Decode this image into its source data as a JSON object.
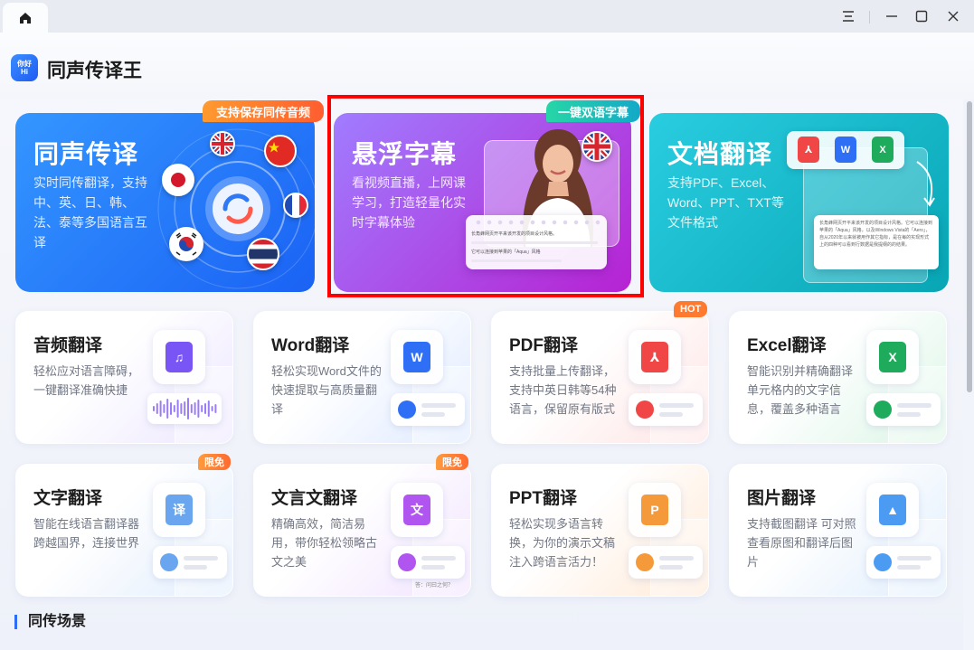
{
  "window": {
    "home_tab_icon": "home-icon",
    "controls": [
      "menu-icon",
      "minimize-icon",
      "maximize-icon",
      "close-icon"
    ]
  },
  "app": {
    "title": "同声传译王",
    "logo_text": "你好\nHi"
  },
  "hero_cards": [
    {
      "id": "simultaneous",
      "title": "同声传译",
      "desc": "实时同传翻译，支持中、英、日、韩、法、泰等多国语言互译",
      "ribbon": "支持保存同传音频",
      "colors": {
        "from": "#2f8cff",
        "to": "#1257f2",
        "ribbon": "#ff7a2f"
      }
    },
    {
      "id": "floating-subtitle",
      "title": "悬浮字幕",
      "desc": "看视频直播，上网课学习，打造轻量化实时字幕体验",
      "ribbon": "一键双语字幕",
      "subtitle_line1": "长角蜂网页开平来该开发的项目设计风格。",
      "subtitle_line2": "它可以连接到苹果的「Aqua」风格",
      "colors": {
        "from": "#a57bff",
        "to": "#b21fd6",
        "ribbon": "#1fc3a5"
      }
    },
    {
      "id": "document",
      "title": "文档翻译",
      "desc": "支持PDF、Excel、Word、PPT、TXT等文件格式",
      "doc_text": "长角蜂网页开平来该开发的项目设计风格。它可以连接到苹果的「Aqua」风格，以及Windows Vista的「Aero」，自从2020年以来就被用作其它指标，是在每的实现形式上的四种可以看到行数据是我提纲的的结果。",
      "colors": {
        "from": "#23c7d9",
        "to": "#0aa7b8"
      }
    }
  ],
  "cards": [
    {
      "id": "audio",
      "title": "音频翻译",
      "desc": "轻松应对语言障碍，一键翻译准确快捷",
      "icon": "music-icon",
      "glyph": "♫",
      "accent": "#7a55f5",
      "tint": "#ece6ff"
    },
    {
      "id": "word",
      "title": "Word翻译",
      "desc": "轻松实现Word文件的快速提取与高质量翻译",
      "icon": "word-doc-icon",
      "glyph": "W",
      "accent": "#2f6ff6",
      "tint": "#dde9ff"
    },
    {
      "id": "pdf",
      "title": "PDF翻译",
      "desc": "支持批量上传翻译，支持中英日韩等54种语言，保留原有版式",
      "icon": "pdf-doc-icon",
      "glyph": "⅄",
      "accent": "#f04646",
      "tint": "#ffe3e3",
      "badge": "HOT"
    },
    {
      "id": "excel",
      "title": "Excel翻译",
      "desc": "智能识别并精确翻译单元格内的文字信息，覆盖多种语言",
      "icon": "excel-doc-icon",
      "glyph": "X",
      "accent": "#1fab5c",
      "tint": "#daf5e6"
    },
    {
      "id": "text",
      "title": "文字翻译",
      "desc": "智能在线语言翻译器跨越国界，连接世界",
      "icon": "translate-doc-icon",
      "glyph": "译",
      "accent": "#6aa6f0",
      "tint": "#e1edfd",
      "badge": "限免"
    },
    {
      "id": "classical",
      "title": "文言文翻译",
      "desc": "精确高效，简洁易用，带你轻松领略古文之美",
      "icon": "classical-doc-icon",
      "glyph": "文",
      "accent": "#b055ef",
      "tint": "#f1e2ff",
      "badge": "限免",
      "chip_text": "答：问曰之何？"
    },
    {
      "id": "ppt",
      "title": "PPT翻译",
      "desc": "轻松实现多语言转换，为你的演示文稿注入跨语言活力！",
      "icon": "ppt-doc-icon",
      "glyph": "P",
      "accent": "#f59a3a",
      "tint": "#ffe9d6"
    },
    {
      "id": "image",
      "title": "图片翻译",
      "desc": "支持截图翻译 可对照查看原图和翻译后图片",
      "icon": "image-doc-icon",
      "glyph": "▲",
      "accent": "#4b9bf2",
      "tint": "#dfedfc"
    }
  ],
  "section": {
    "title": "同传场景"
  }
}
